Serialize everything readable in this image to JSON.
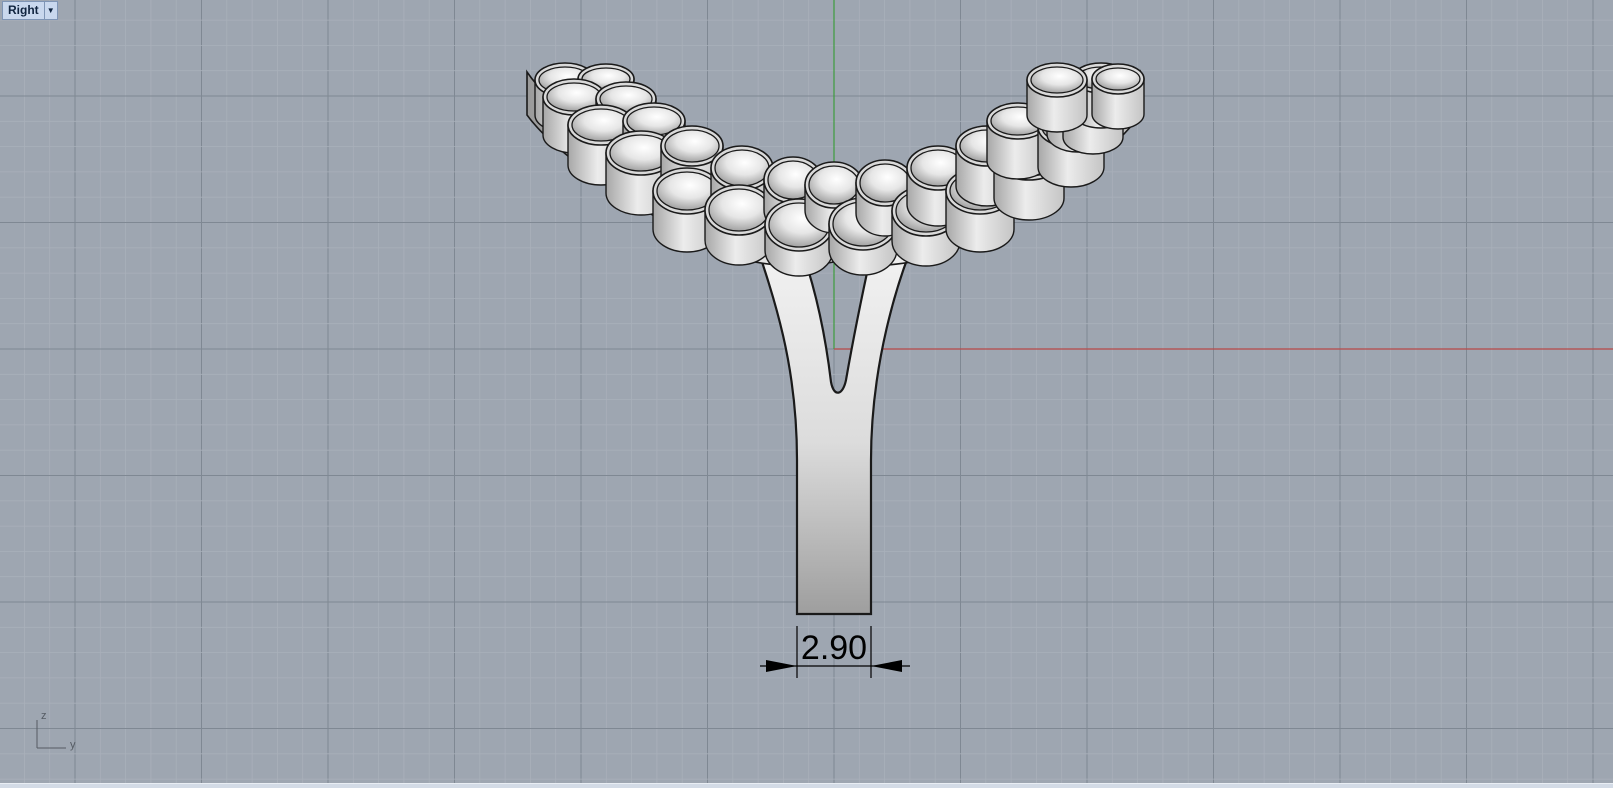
{
  "viewport": {
    "name": "Right",
    "menu_icon": "chevron-down-icon",
    "background_color": "#9ea6b1",
    "grid_minor_color": "#a9b0ba",
    "grid_major_color": "#7f8893",
    "x_axis_color": "#b94848",
    "y_axis_color": "#3d9c3d"
  },
  "model": {
    "description_icon": "ring-with-pave-gems",
    "metal_color": "#dadada",
    "gem_color": "#eeeeee"
  },
  "dimension": {
    "value_text": "2.90"
  },
  "axis_widget": {
    "vertical_label": "z",
    "horizontal_label": "y"
  }
}
